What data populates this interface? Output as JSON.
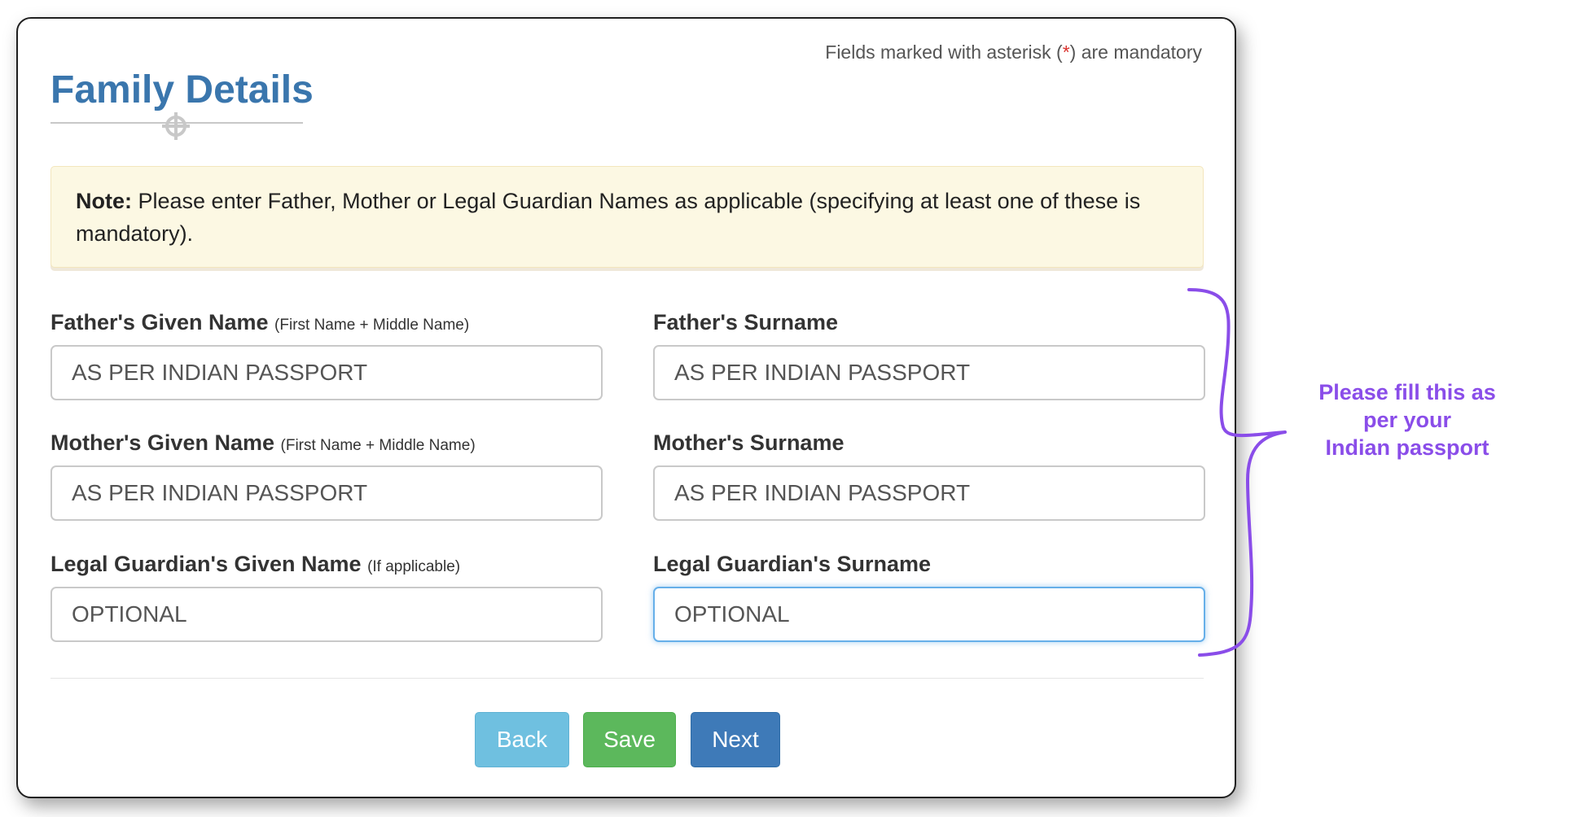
{
  "page": {
    "title": "Family Details",
    "mandatory_note": {
      "before": "Fields marked with asterisk (",
      "asterisk": "*",
      "after": ") are mandatory"
    },
    "crosshair_icon": "crosshair-icon"
  },
  "alert": {
    "label": "Note:",
    "text": " Please enter Father, Mother or Legal Guardian Names as applicable (specifying at least one of these is mandatory)."
  },
  "fields": {
    "father_given": {
      "label": "Father's Given Name",
      "hint": "(First Name + Middle Name)",
      "value": "AS PER INDIAN PASSPORT"
    },
    "father_surname": {
      "label": "Father's Surname",
      "value": "AS PER INDIAN PASSPORT"
    },
    "mother_given": {
      "label": "Mother's Given Name",
      "hint": "(First Name + Middle Name)",
      "value": "AS PER INDIAN PASSPORT"
    },
    "mother_surname": {
      "label": "Mother's Surname",
      "value": "AS PER INDIAN PASSPORT"
    },
    "guardian_given": {
      "label": "Legal Guardian's Given Name",
      "hint": "(If applicable)",
      "value": "OPTIONAL"
    },
    "guardian_surname": {
      "label": "Legal Guardian's Surname",
      "value": "OPTIONAL"
    }
  },
  "buttons": {
    "back": "Back",
    "save": "Save",
    "next": "Next"
  },
  "annotation": {
    "line1": "Please fill this as",
    "line2": "per your",
    "line3": "Indian passport",
    "color": "#8a4de9"
  },
  "colors": {
    "title": "#3a76ad",
    "alert_bg": "#fcf8e3",
    "back": "#6fc0e0",
    "save": "#5cb85c",
    "next": "#3e7ab8",
    "focus": "#66afe9"
  }
}
